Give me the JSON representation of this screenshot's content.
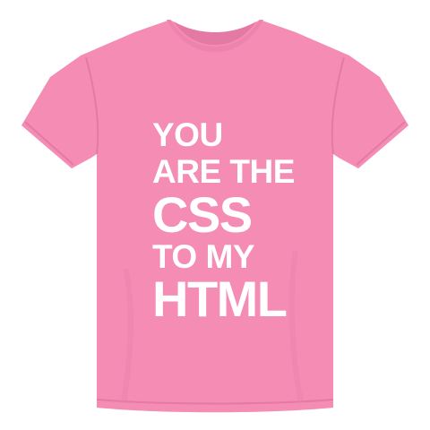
{
  "shirt": {
    "color": "#f48cb4",
    "shade_color": "#e47aa3",
    "collar_color": "#ee83ad"
  },
  "print": {
    "color": "#ffffff",
    "lines": [
      "YOU",
      "ARE THE",
      "CSS",
      "TO MY",
      "HTML"
    ]
  },
  "icons": {
    "garment": "t-shirt-icon"
  }
}
